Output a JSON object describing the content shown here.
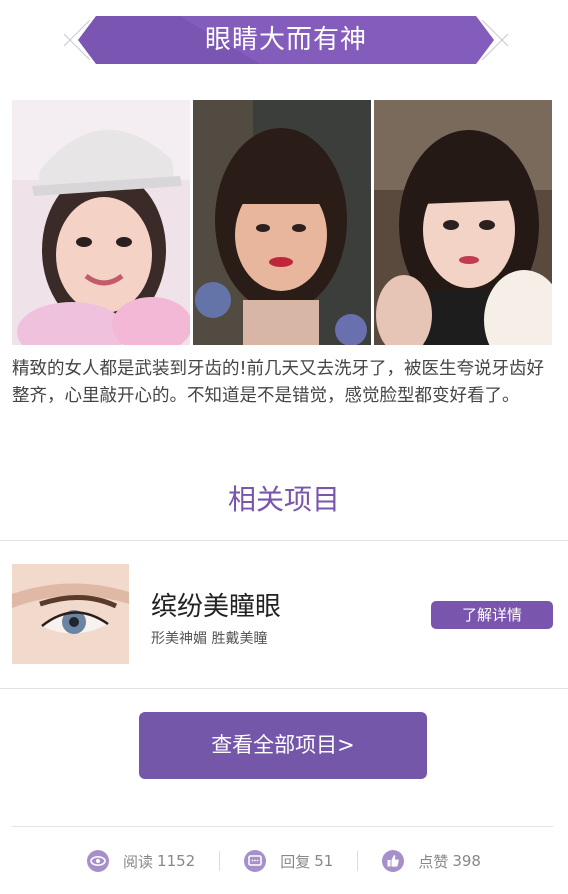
{
  "banner": {
    "title": "眼睛大而有神"
  },
  "description": "精致的女人都是武装到牙齿的!前几天又去洗牙了，被医生夸说牙齿好整齐，心里敲开心的。不知道是不是错觉，感觉脸型都变好看了。",
  "related": {
    "title": "相关项目"
  },
  "project": {
    "name": "缤纷美瞳眼",
    "tagline": "形美神媚 胜戴美瞳",
    "detail_label": "了解详情"
  },
  "view_all_label": "查看全部项目>",
  "stats": {
    "read": {
      "label": "阅读",
      "count": "1152",
      "icon": "eye-icon"
    },
    "reply": {
      "label": "回复",
      "count": "51",
      "icon": "comment-icon"
    },
    "like": {
      "label": "点赞",
      "count": "398",
      "icon": "thumbs-up-icon"
    }
  },
  "colors": {
    "accent": "#7a55ad",
    "button": "#7457a8",
    "icon": "#a68fca"
  }
}
